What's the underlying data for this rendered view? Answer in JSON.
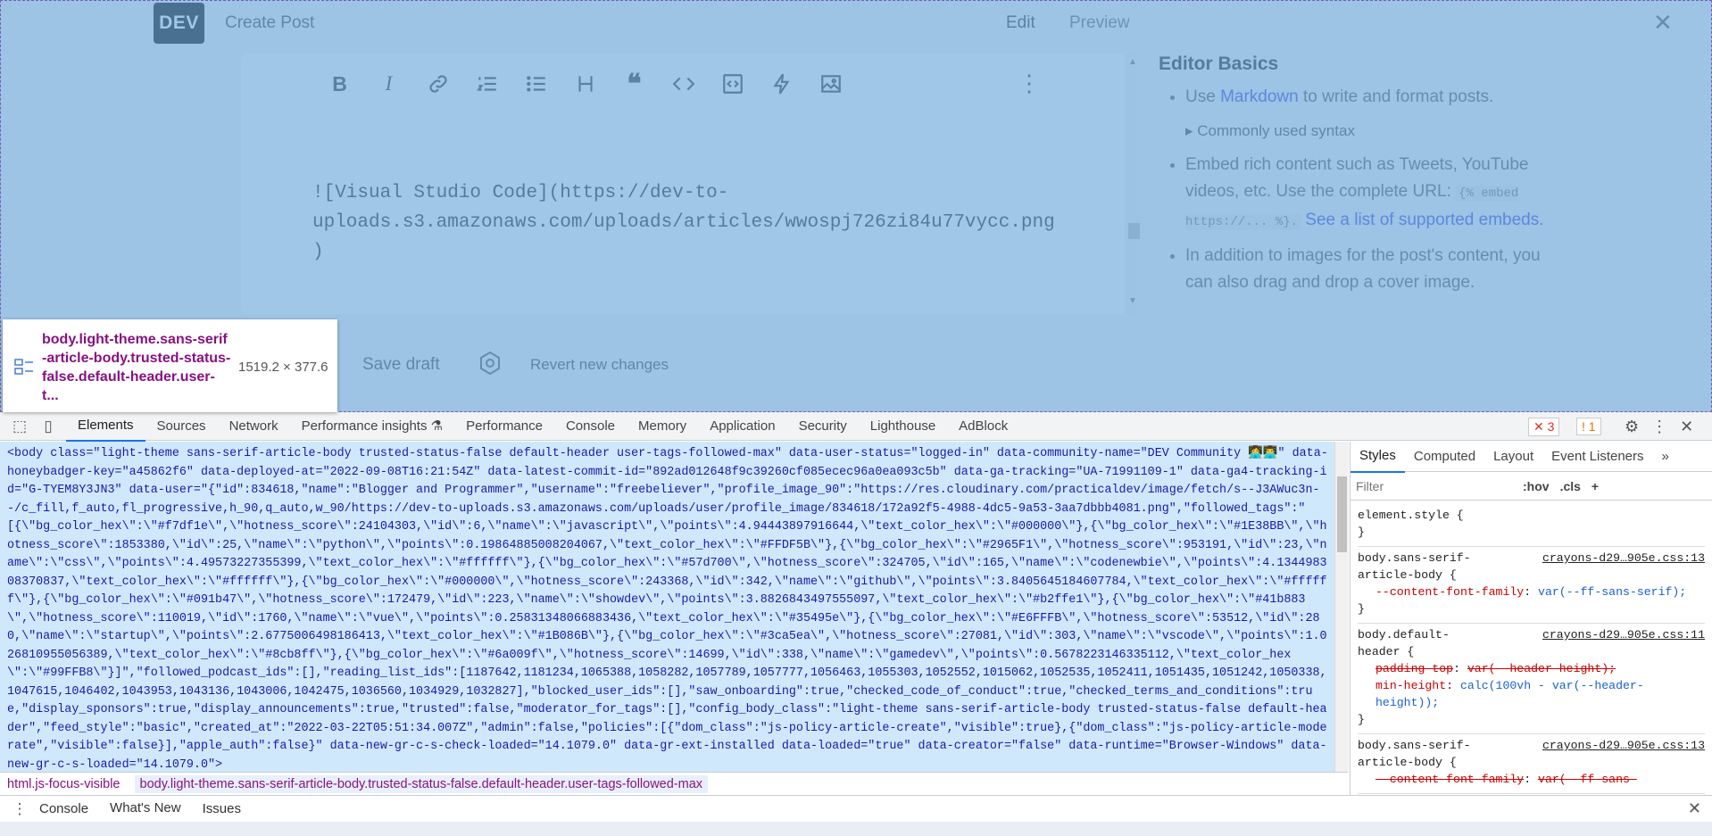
{
  "header": {
    "logo": "DEV",
    "title": "Create Post",
    "edit": "Edit",
    "preview": "Preview",
    "close": "✕"
  },
  "editor": {
    "toolbar": [
      "bold-icon",
      "italic-icon",
      "link-icon",
      "ordered-list-icon",
      "unordered-list-icon",
      "heading-icon",
      "quote-icon",
      "code-icon",
      "code-block-icon",
      "embed-icon",
      "image-icon"
    ],
    "toolbar_glyphs": [
      "B",
      "I",
      "⛓",
      "⋮≡",
      "≡",
      "H",
      "❝",
      "<>",
      "[ ]",
      "ϟ",
      "▨"
    ],
    "more": "⋮",
    "content": "![Visual Studio Code](https://dev-to-\nuploads.s3.amazonaws.com/uploads/articles/wwospj726zi84u77vycc.png\n)"
  },
  "help": {
    "title": "Editor Basics",
    "b1_pre": "Use ",
    "b1_link": "Markdown",
    "b1_post": " to write and format posts.",
    "b1_sub": "▸ Commonly used syntax",
    "b2_pre": "Embed rich content such as Tweets, YouTube videos, etc. Use the complete URL: ",
    "b2_code": "{% embed https://... %}.",
    "b2_link": " See a list of supported embeds.",
    "b3": "In addition to images for the post's content, you can also drag and drop a cover image."
  },
  "actions": {
    "save": "Save draft",
    "revert": "Revert new changes"
  },
  "tooltip": {
    "selector": "body.light-theme.sans-serif-article-body.trusted-status-false.default-header.user-t...",
    "dims": "1519.2 × 377.6"
  },
  "devtools": {
    "tabs": [
      "Elements",
      "Sources",
      "Network",
      "Performance insights ⚗",
      "Performance",
      "Console",
      "Memory",
      "Application",
      "Security",
      "Lighthouse",
      "AdBlock"
    ],
    "errors": "✕ 3",
    "warnings": "! 1",
    "element_text": "<body class=\"light-theme sans-serif-article-body trusted-status-false default-header user-tags-followed-max\" data-user-status=\"logged-in\" data-community-name=\"DEV Community 👩‍💻👨‍💻\" data-honeybadger-key=\"a45862f6\" data-deployed-at=\"2022-09-08T16:21:54Z\" data-latest-commit-id=\"892ad012648f9c39260cf085ecec96a0ea093c5b\" data-ga-tracking=\"UA-71991109-1\" data-ga4-tracking-id=\"G-TYEM8Y3JN3\" data-user=\"{\"id\":834618,\"name\":\"Blogger and Programmer\",\"username\":\"freebeliever\",\"profile_image_90\":\"https://res.cloudinary.com/practicaldev/image/fetch/s--J3AWuc3n--/c_fill,f_auto,fl_progressive,h_90,q_auto,w_90/https://dev-to-uploads.s3.amazonaws.com/uploads/user/profile_image/834618/172a92f5-4988-4dc5-9a53-3aa7dbbb4081.png\",\"followed_tags\":\"[{\\\"bg_color_hex\\\":\\\"#f7df1e\\\",\\\"hotness_score\\\":24104303,\\\"id\\\":6,\\\"name\\\":\\\"javascript\\\",\\\"points\\\":4.94443897916644,\\\"text_color_hex\\\":\\\"#000000\\\"},{\\\"bg_color_hex\\\":\\\"#1E38BB\\\",\\\"hotness_score\\\":1853380,\\\"id\\\":25,\\\"name\\\":\\\"python\\\",\\\"points\\\":0.19864885008204067,\\\"text_color_hex\\\":\\\"#FFDF5B\\\"},{\\\"bg_color_hex\\\":\\\"#2965F1\\\",\\\"hotness_score\\\":953191,\\\"id\\\":23,\\\"name\\\":\\\"css\\\",\\\"points\\\":4.49573227355399,\\\"text_color_hex\\\":\\\"#ffffff\\\"},{\\\"bg_color_hex\\\":\\\"#57d700\\\",\\\"hotness_score\\\":324705,\\\"id\\\":165,\\\"name\\\":\\\"codenewbie\\\",\\\"points\\\":4.134498308370837,\\\"text_color_hex\\\":\\\"#ffffff\\\"},{\\\"bg_color_hex\\\":\\\"#000000\\\",\\\"hotness_score\\\":243368,\\\"id\\\":342,\\\"name\\\":\\\"github\\\",\\\"points\\\":3.8405645184607784,\\\"text_color_hex\\\":\\\"#ffffff\\\"},{\\\"bg_color_hex\\\":\\\"#091b47\\\",\\\"hotness_score\\\":172479,\\\"id\\\":223,\\\"name\\\":\\\"showdev\\\",\\\"points\\\":3.8826843497555097,\\\"text_color_hex\\\":\\\"#b2ffe1\\\"},{\\\"bg_color_hex\\\":\\\"#41b883\\\",\\\"hotness_score\\\":110019,\\\"id\\\":1760,\\\"name\\\":\\\"vue\\\",\\\"points\\\":0.25831348066883436,\\\"text_color_hex\\\":\\\"#35495e\\\"},{\\\"bg_color_hex\\\":\\\"#E6FFFB\\\",\\\"hotness_score\\\":53512,\\\"id\\\":280,\\\"name\\\":\\\"startup\\\",\\\"points\\\":2.6775006498186413,\\\"text_color_hex\\\":\\\"#1B086B\\\"},{\\\"bg_color_hex\\\":\\\"#3ca5ea\\\",\\\"hotness_score\\\":27081,\\\"id\\\":303,\\\"name\\\":\\\"vscode\\\",\\\"points\\\":1.026810955056389,\\\"text_color_hex\\\":\\\"#8cb8ff\\\"},{\\\"bg_color_hex\\\":\\\"#6a009f\\\",\\\"hotness_score\\\":14699,\\\"id\\\":338,\\\"name\\\":\\\"gamedev\\\",\\\"points\\\":0.5678223146335112,\\\"text_color_hex\\\":\\\"#99FFB8\\\"}]\",\"followed_podcast_ids\":[],\"reading_list_ids\":[1187642,1181234,1065388,1058282,1057789,1057777,1056463,1055303,1052552,1015062,1052535,1052411,1051435,1051242,1050338,1047615,1046402,1043953,1043136,1043006,1042475,1036560,1034929,1032827],\"blocked_user_ids\":[],\"saw_onboarding\":true,\"checked_code_of_conduct\":true,\"checked_terms_and_conditions\":true,\"display_sponsors\":true,\"display_announcements\":true,\"trusted\":false,\"moderator_for_tags\":[],\"config_body_class\":\"light-theme sans-serif-article-body trusted-status-false default-header\",\"feed_style\":\"basic\",\"created_at\":\"2022-03-22T05:51:34.007Z\",\"admin\":false,\"policies\":[{\"dom_class\":\"js-policy-article-create\",\"visible\":true},{\"dom_class\":\"js-policy-article-moderate\",\"visible\":false}],\"apple_auth\":false}\" data-new-gr-c-s-check-loaded=\"14.1079.0\" data-gr-ext-installed data-loaded=\"true\" data-creator=\"false\" data-runtime=\"Browser-Windows\" data-new-gr-c-s-loaded=\"14.1079.0\">",
    "crumb1": "html.js-focus-visible",
    "crumb2": "body.light-theme.sans-serif-article-body.trusted-status-false.default-header.user-tags-followed-max",
    "styles_tabs": [
      "Styles",
      "Computed",
      "Layout",
      "Event Listeners",
      "»"
    ],
    "filter_placeholder": "Filter",
    "hov": ":hov",
    "cls": ".cls",
    "rules": [
      {
        "sel": "element.style {",
        "src": "",
        "decls": []
      },
      {
        "sel": "body.sans-serif-article-body {",
        "src": "crayons-d29…905e.css:13",
        "decls": [
          [
            "--content-font-family",
            "var(--ff-sans-serif);"
          ]
        ]
      },
      {
        "sel": "body.default-header {",
        "src": "crayons-d29…905e.css:11",
        "decls": [
          [
            "padding-top",
            "var(--header-height);"
          ],
          [
            "min-height",
            "calc(100vh - var(--header-height));"
          ]
        ]
      },
      {
        "sel": "body.sans-serif-article-body {",
        "src": "crayons-d29…905e.css:13",
        "decls": [
          [
            "--content-font-family",
            "var(--ff-sans-"
          ]
        ]
      }
    ],
    "drawer_tabs": [
      "Console",
      "What's New",
      "Issues"
    ]
  }
}
